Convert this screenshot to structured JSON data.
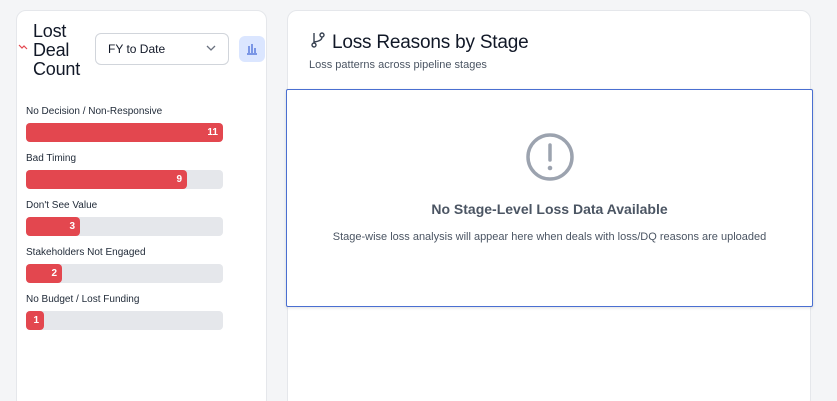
{
  "lost_deals": {
    "title_lines": [
      "Lost",
      "Deal",
      "Count"
    ],
    "period_select": {
      "value": "FY to Date"
    },
    "bar_color": "#e3474f",
    "bars": [
      {
        "label": "No Decision / Non-Responsive",
        "value": "11",
        "fraction": 1.0
      },
      {
        "label": "Bad Timing",
        "value": "9",
        "fraction": 0.818
      },
      {
        "label": "Don't See Value",
        "value": "3",
        "fraction": 0.273
      },
      {
        "label": "Stakeholders Not Engaged",
        "value": "2",
        "fraction": 0.182
      },
      {
        "label": "No Budget / Lost Funding",
        "value": "1",
        "fraction": 0.091
      }
    ]
  },
  "loss_reasons": {
    "title": "Loss Reasons by Stage",
    "subtitle": "Loss patterns across pipeline stages",
    "empty_state": {
      "title": "No Stage-Level Loss Data Available",
      "description": "Stage-wise loss analysis will appear here when deals with loss/DQ reasons are uploaded"
    }
  },
  "icons": [
    "trend-down-icon",
    "chevron-down-icon",
    "bar-chart-icon",
    "git-branch-icon",
    "alert-circle-icon"
  ]
}
